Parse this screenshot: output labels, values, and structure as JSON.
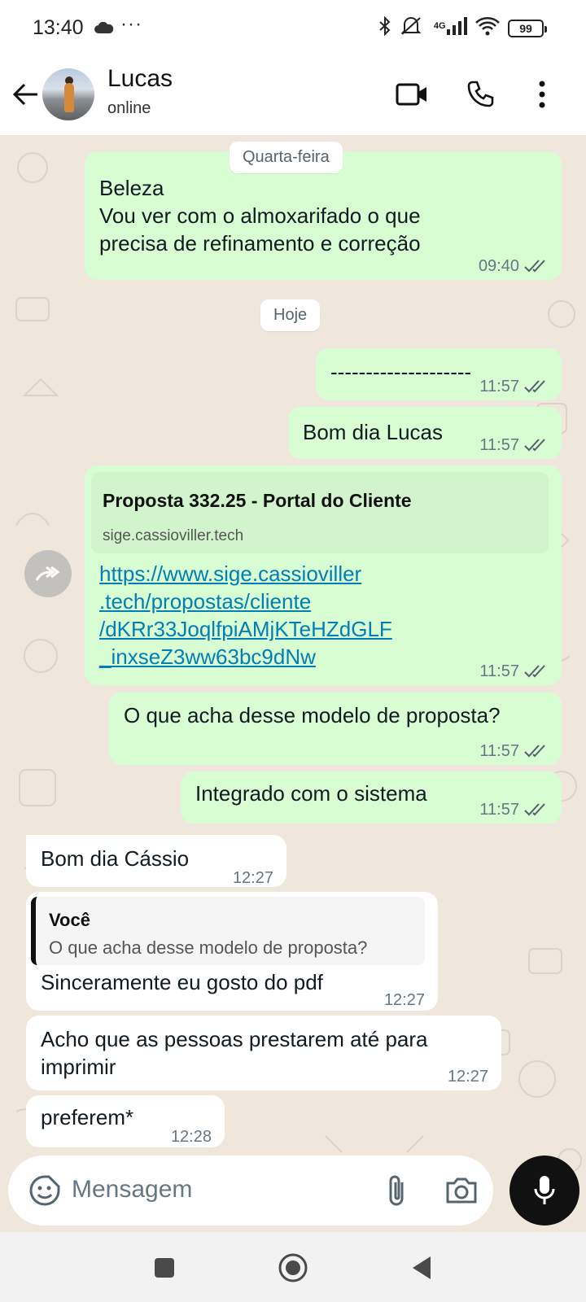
{
  "status_bar": {
    "time": "13:40",
    "dots": "···",
    "network": "4G",
    "battery": "99"
  },
  "header": {
    "name": "Lucas",
    "status": "online"
  },
  "day_chips": {
    "wednesday": "Quarta-feira",
    "today": "Hoje"
  },
  "messages": [
    {
      "dir": "out",
      "text": "Beleza\nVou ver com o almoxarifado o que\nprecisa de refinamento e correção",
      "time": "09:40",
      "read": true
    },
    {
      "dir": "out",
      "text": "--------------------",
      "time": "11:57",
      "read": true
    },
    {
      "dir": "out",
      "text": "Bom dia Lucas",
      "time": "11:57",
      "read": true
    },
    {
      "dir": "out",
      "type": "link",
      "preview_title": "Proposta 332.25 - Portal do Cliente",
      "preview_domain": "sige.cassioviller.tech",
      "url_text": "https://www.sige.cassioviller\n.tech/propostas/cliente\n/dKRr33JoqlfpiAMjKTeHZdGLF\n_inxseZ3ww63bc9dNw",
      "time": "11:57",
      "read": true
    },
    {
      "dir": "out",
      "text": "O que acha desse modelo de proposta?",
      "time": "11:57",
      "read": true
    },
    {
      "dir": "out",
      "text": "Integrado com o sistema",
      "time": "11:57",
      "read": true
    },
    {
      "dir": "in",
      "text": "Bom dia Cássio",
      "time": "12:27"
    },
    {
      "dir": "in",
      "type": "reply",
      "quote_author": "Você",
      "quote_text": "O que acha desse modelo de proposta?",
      "text": "Sinceramente eu gosto do pdf",
      "time": "12:27"
    },
    {
      "dir": "in",
      "text": "Acho que as pessoas prestarem até para\nimprimir",
      "time": "12:27"
    },
    {
      "dir": "in",
      "text": "preferem*",
      "time": "12:28"
    }
  ],
  "composer": {
    "placeholder": "Mensagem"
  },
  "colors": {
    "outgoing_bubble": "#d9fdd3",
    "incoming_bubble": "#ffffff",
    "chat_background": "#efe7dc",
    "link": "#027eb5",
    "read_ticks": "#53606a"
  }
}
